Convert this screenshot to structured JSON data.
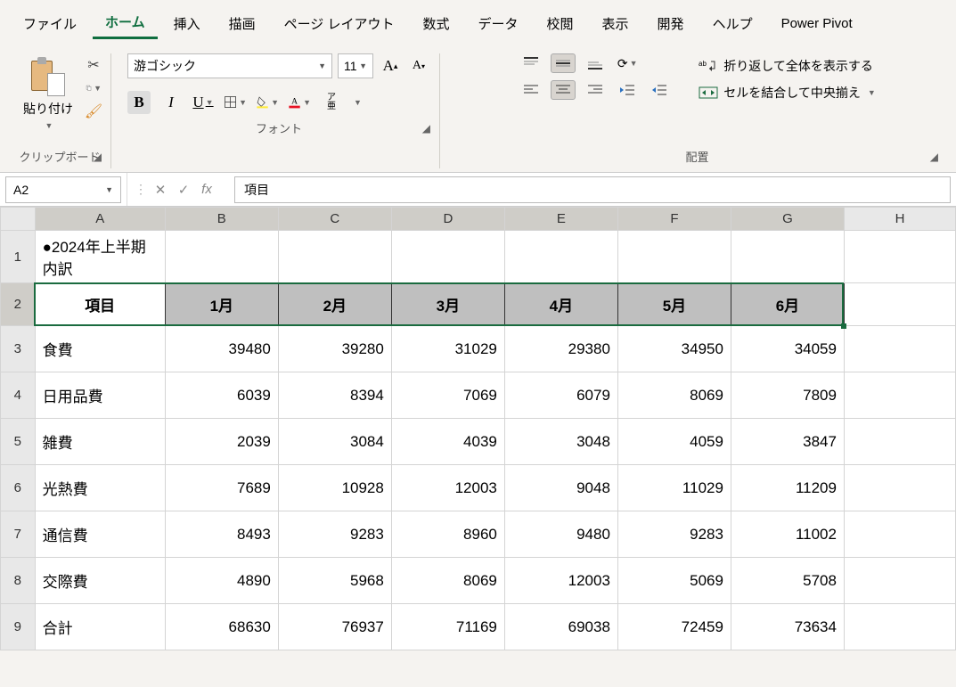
{
  "menu": [
    "ファイル",
    "ホーム",
    "挿入",
    "描画",
    "ページ レイアウト",
    "数式",
    "データ",
    "校閲",
    "表示",
    "開発",
    "ヘルプ",
    "Power Pivot"
  ],
  "menu_active": 1,
  "ribbon": {
    "clipboard": {
      "paste": "貼り付け",
      "label": "クリップボード"
    },
    "font": {
      "name": "游ゴシック",
      "size": "11",
      "label": "フォント",
      "ruby": "ア\n亜"
    },
    "align": {
      "label": "配置",
      "wrap": "折り返して全体を表示する",
      "merge": "セルを結合して中央揃え"
    }
  },
  "namebox": "A2",
  "formula": "項目",
  "cols": [
    "A",
    "B",
    "C",
    "D",
    "E",
    "F",
    "G",
    "H"
  ],
  "rows": [
    "1",
    "2",
    "3",
    "4",
    "5",
    "6",
    "7",
    "8",
    "9"
  ],
  "title": "●2024年上半期内訳",
  "headers": [
    "項目",
    "1月",
    "2月",
    "3月",
    "4月",
    "5月",
    "6月"
  ],
  "data": [
    [
      "食費",
      "39480",
      "39280",
      "31029",
      "29380",
      "34950",
      "34059"
    ],
    [
      "日用品費",
      "6039",
      "8394",
      "7069",
      "6079",
      "8069",
      "7809"
    ],
    [
      "雑費",
      "2039",
      "3084",
      "4039",
      "3048",
      "4059",
      "3847"
    ],
    [
      "光熱費",
      "7689",
      "10928",
      "12003",
      "9048",
      "11029",
      "11209"
    ],
    [
      "通信費",
      "8493",
      "9283",
      "8960",
      "9480",
      "9283",
      "11002"
    ],
    [
      "交際費",
      "4890",
      "5968",
      "8069",
      "12003",
      "5069",
      "5708"
    ],
    [
      "合計",
      "68630",
      "76937",
      "71169",
      "69038",
      "72459",
      "73634"
    ]
  ]
}
